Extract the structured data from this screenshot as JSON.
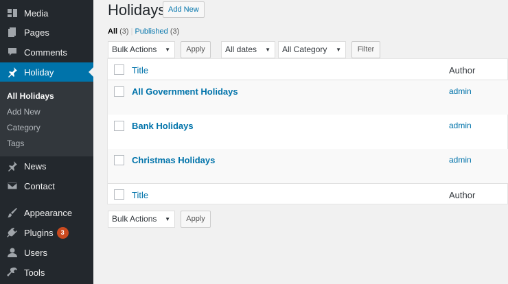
{
  "sidebar": {
    "items": [
      {
        "label": "Media",
        "icon": "media-icon"
      },
      {
        "label": "Pages",
        "icon": "pages-icon"
      },
      {
        "label": "Comments",
        "icon": "comments-icon"
      },
      {
        "label": "Holiday",
        "icon": "pin-icon"
      },
      {
        "label": "News",
        "icon": "pin-icon"
      },
      {
        "label": "Contact",
        "icon": "mail-icon"
      },
      {
        "label": "Appearance",
        "icon": "brush-icon"
      },
      {
        "label": "Plugins",
        "icon": "plugin-icon",
        "badge": "3"
      },
      {
        "label": "Users",
        "icon": "user-icon"
      },
      {
        "label": "Tools",
        "icon": "wrench-icon"
      }
    ],
    "submenu": [
      "All Holidays",
      "Add New",
      "Category",
      "Tags"
    ]
  },
  "page": {
    "title": "Holidays",
    "add_new": "Add New"
  },
  "views": {
    "all_label": "All",
    "all_count": "(3)",
    "separator": "|",
    "published_label": "Published",
    "published_count": "(3)"
  },
  "filters": {
    "bulk_actions": "Bulk Actions",
    "apply": "Apply",
    "dates": "All dates",
    "category": "All Category",
    "filter": "Filter"
  },
  "table": {
    "col_title": "Title",
    "col_author": "Author",
    "rows": [
      {
        "title": "All Government Holidays",
        "author": "admin"
      },
      {
        "title": "Bank Holidays",
        "author": "admin"
      },
      {
        "title": "Christmas Holidays",
        "author": "admin"
      }
    ]
  },
  "bottom": {
    "bulk_actions": "Bulk Actions",
    "apply": "Apply"
  },
  "colors": {
    "sidebar_bg": "#23282d",
    "submenu_bg": "#32373c",
    "active": "#0073aa",
    "link": "#0073aa",
    "badge": "#ca4a1f"
  }
}
